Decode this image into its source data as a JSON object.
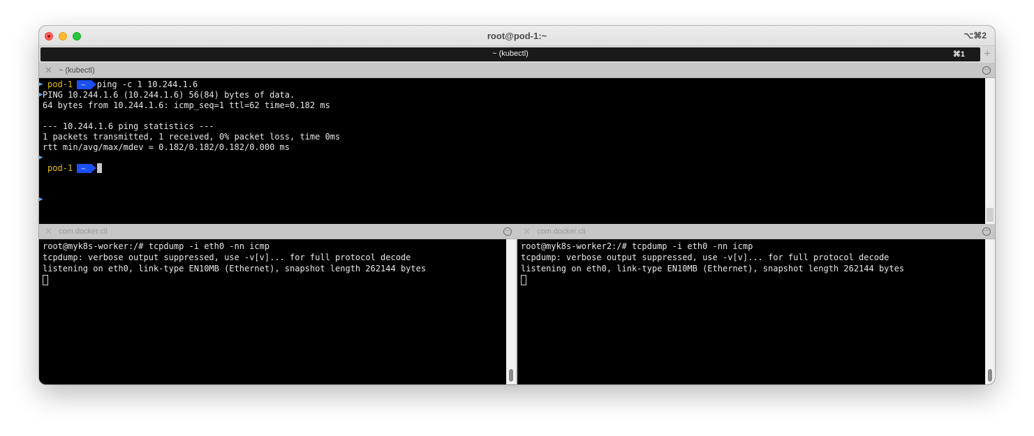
{
  "window": {
    "title": "root@pod-1:~",
    "shortcut": "⌥⌘2"
  },
  "tab": {
    "label": "~ (kubectl)",
    "shortcut": "⌘1",
    "new_tab": "+"
  },
  "top_session": {
    "title": "~ (kubectl)",
    "prompt_host": "pod-1",
    "prompt_dir": "~",
    "command": "ping -c 1 10.244.1.6",
    "output": [
      "PING 10.244.1.6 (10.244.1.6) 56(84) bytes of data.",
      "64 bytes from 10.244.1.6: icmp_seq=1 ttl=62 time=0.182 ms",
      "",
      "--- 10.244.1.6 ping statistics ---",
      "1 packets transmitted, 1 received, 0% packet loss, time 0ms",
      "rtt min/avg/max/mdev = 0.182/0.182/0.182/0.000 ms"
    ]
  },
  "left_session": {
    "title": "com.docker.cli",
    "lines": [
      "root@myk8s-worker:/# tcpdump -i eth0 -nn icmp",
      "tcpdump: verbose output suppressed, use -v[v]... for full protocol decode",
      "listening on eth0, link-type EN10MB (Ethernet), snapshot length 262144 bytes"
    ]
  },
  "right_session": {
    "title": "com.docker.cli",
    "lines": [
      "root@myk8s-worker2:/# tcpdump -i eth0 -nn icmp",
      "tcpdump: verbose output suppressed, use -v[v]... for full protocol decode",
      "listening on eth0, link-type EN10MB (Ethernet), snapshot length 262144 bytes"
    ]
  },
  "icons": {
    "close": "✕",
    "menu": "···",
    "gutter_mark": "▶"
  },
  "colors": {
    "prompt_host": "#e5c100",
    "prompt_segment": "#1a4ff0",
    "gutter_mark": "#5aa9ff"
  }
}
